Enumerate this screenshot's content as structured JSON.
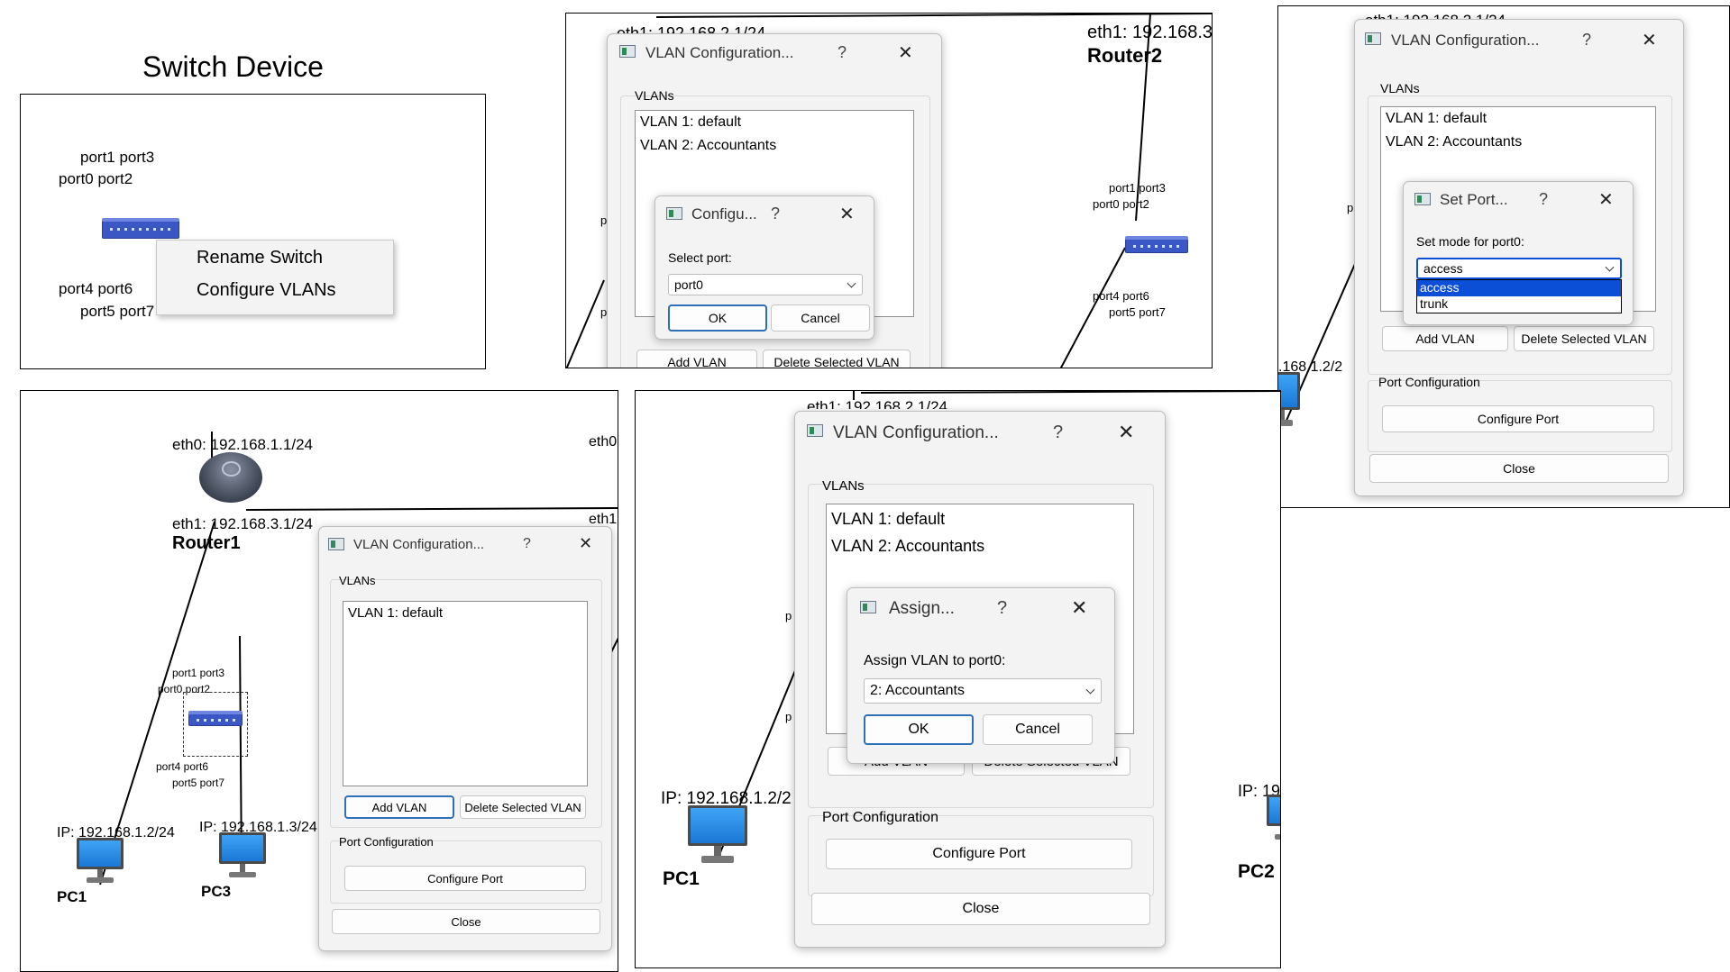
{
  "title": "Switch Device",
  "context_menu": {
    "items": [
      "Rename Switch",
      "Configure VLANs"
    ]
  },
  "ports": {
    "p13": "port1 port3",
    "p02": "port0 port2",
    "p46": "port4 port6",
    "p57": "port5 port7",
    "p13b": "port1 port3",
    "p02b": "port0 port2",
    "p46b": "port4 port6",
    "p57b": "port5 port7",
    "p13c": "port1 port3",
    "p02c": "port0 port2",
    "p46c": "port4 port6",
    "p57c": "port5 port7",
    "p13d": "port1 port3",
    "p02d": "port0 port2",
    "p46d": "port4 port6",
    "p57d": "port5 port7"
  },
  "labels": {
    "router1": "Router1",
    "router2": "Router2",
    "r1_eth0": "eth0: 192.168.1.1/24",
    "r1_eth1": "eth1: 192.168.3.1/24",
    "r2_eth1": "eth1: 192.168.3",
    "top_eth1": "eth1: 192.168.2.1/24",
    "eth0_frag": "eth0",
    "eth1_frag": "eth1",
    "pc1": "PC1",
    "pc3": "PC3",
    "pc2": "PC2",
    "pc1_ip": "IP: 192.168.1.2/24",
    "pc3_ip": "IP: 192.168.1.3/24",
    "pc1_ip_b": "IP: 192.168.1.2/2",
    "pc2_ip": "IP: 19",
    "ip_frag": ".168.1.2/2",
    "p_frag": "p"
  },
  "vlan_dialog": {
    "title": "VLAN Configuration...",
    "help": "?",
    "close_x": "✕",
    "vlans_group": "VLANs",
    "vlans_initial": [
      "VLAN 1: default"
    ],
    "vlans": [
      "VLAN 1: default",
      "VLAN 2: Accountants"
    ],
    "add_vlan": "Add VLAN",
    "delete_vlan": "Delete Selected VLAN",
    "port_config_group": "Port Configuration",
    "configure_port": "Configure Port",
    "close": "Close"
  },
  "config_dialog": {
    "title": "Configu...",
    "prompt": "Select port:",
    "selected": "port0",
    "ok": "OK",
    "cancel": "Cancel"
  },
  "setport_dialog": {
    "title": "Set Port...",
    "prompt": "Set mode for port0:",
    "selected": "access",
    "options": [
      "access",
      "trunk"
    ]
  },
  "assign_dialog": {
    "title": "Assign...",
    "prompt": "Assign VLAN to port0:",
    "selected": "2: Accountants",
    "ok": "OK",
    "cancel": "Cancel"
  },
  "colors": {
    "focus_blue": "#2f6fb7",
    "selection_blue": "#0a4fd6",
    "switch_blue": "#3b57c5"
  }
}
